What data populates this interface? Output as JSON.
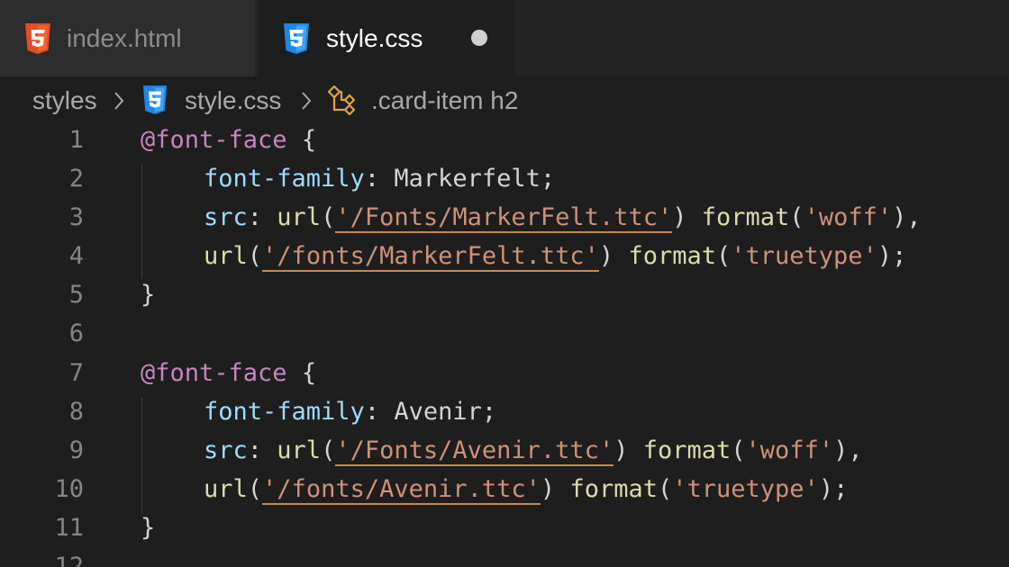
{
  "tabs": [
    {
      "label": "index.html",
      "icon": "html5-icon",
      "active": false
    },
    {
      "label": "style.css",
      "icon": "css3-icon",
      "active": true,
      "dirty": true
    }
  ],
  "breadcrumb": {
    "folder": "styles",
    "file": "style.css",
    "symbol": ".card-item h2"
  },
  "colors": {
    "html_icon": "#e44d26",
    "css_icon": "#42a5f5",
    "symbol_icon": "#e2a53a",
    "at_rule": "#c586c0",
    "property": "#9cdcfe",
    "function": "#dcdcaa",
    "string": "#ce9178"
  },
  "editor": {
    "line_numbers": [
      "1",
      "2",
      "3",
      "4",
      "5",
      "6",
      "7",
      "8",
      "9",
      "10",
      "11",
      "12"
    ],
    "tokens": {
      "at_font_face": "@font-face",
      "brace_open": " {",
      "brace_close": "}",
      "font_family": "font-family",
      "src": "src",
      "colon": ": ",
      "url": "url",
      "format": "format",
      "paren_open": "(",
      "paren_close": ")",
      "semicolon": ";",
      "comma": ",",
      "space": " "
    },
    "block1": {
      "family_value": "Markerfelt",
      "src1_url": "'/Fonts/MarkerFelt.ttc'",
      "src1_format": "'woff'",
      "src2_url": "'/fonts/MarkerFelt.ttc'",
      "src2_format": "'truetype'"
    },
    "block2": {
      "family_value": "Avenir",
      "src1_url": "'/Fonts/Avenir.ttc'",
      "src1_format": "'woff'",
      "src2_url": "'/fonts/Avenir.ttc'",
      "src2_format": "'truetype'"
    }
  }
}
